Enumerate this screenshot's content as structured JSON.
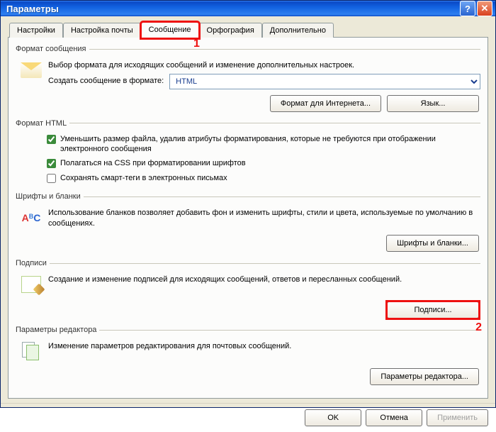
{
  "window": {
    "title": "Параметры"
  },
  "tabs": [
    {
      "label": "Настройки"
    },
    {
      "label": "Настройка почты"
    },
    {
      "label": "Сообщение"
    },
    {
      "label": "Орфография"
    },
    {
      "label": "Дополнительно"
    }
  ],
  "callouts": {
    "one": "1",
    "two": "2"
  },
  "group_format": {
    "legend": "Формат сообщения",
    "desc": "Выбор формата для исходящих сообщений и изменение дополнительных настроек.",
    "create_label": "Создать сообщение в формате:",
    "combo_value": "HTML",
    "btn_internet": "Формат для Интернета...",
    "btn_lang": "Язык..."
  },
  "group_html": {
    "legend": "Формат HTML",
    "cb1": "Уменьшить размер файла, удалив атрибуты форматирования, которые не требуются при отображении электронного сообщения",
    "cb2": "Полагаться на CSS при форматировании шрифтов",
    "cb3": "Сохранять смарт-теги в электронных письмах"
  },
  "group_fonts": {
    "legend": "Шрифты и бланки",
    "desc": "Использование бланков позволяет добавить фон и изменить шрифты, стили и цвета, используемые по умолчанию в сообщениях.",
    "btn": "Шрифты и бланки..."
  },
  "group_sign": {
    "legend": "Подписи",
    "desc": "Создание и изменение подписей для исходящих сообщений, ответов и пересланных сообщений.",
    "btn": "Подписи..."
  },
  "group_editor": {
    "legend": "Параметры редактора",
    "desc": "Изменение параметров редактирования для почтовых сообщений.",
    "btn": "Параметры редактора..."
  },
  "footer": {
    "ok": "OK",
    "cancel": "Отмена",
    "apply": "Применить"
  }
}
